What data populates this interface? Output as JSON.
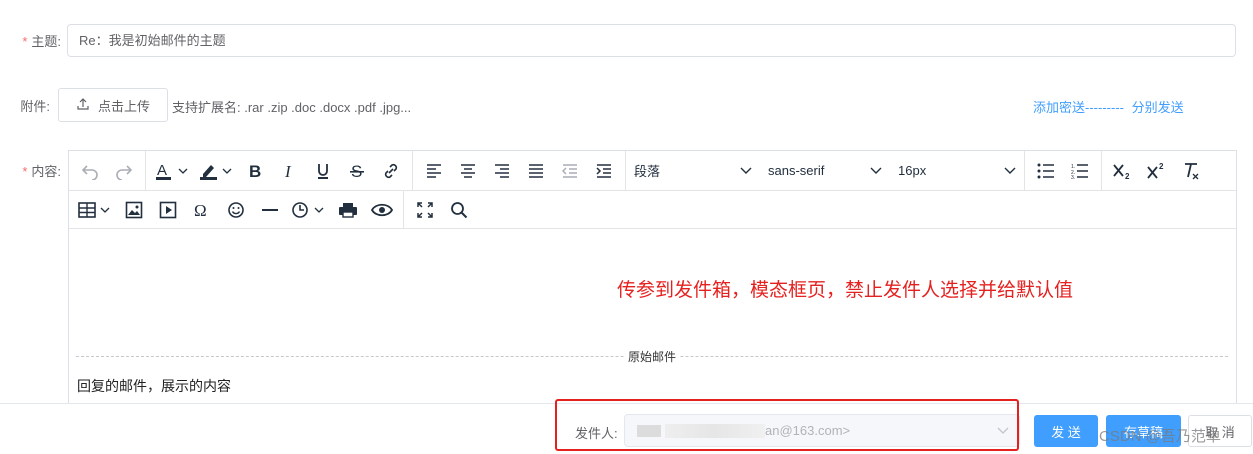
{
  "form": {
    "subject": {
      "label": "主题:",
      "required": true,
      "value": "Re：我是初始邮件的主题"
    },
    "attachment": {
      "label": "附件:",
      "upload_button": "点击上传",
      "hint": "支持扩展名: .rar .zip .doc .docx .pdf .jpg...",
      "add_cc_link": "添加密送---------",
      "separate_send_link": "分别发送"
    },
    "content": {
      "label": "内容:",
      "required": true
    }
  },
  "editor": {
    "toolbar": {
      "block_format": "段落",
      "font_family": "sans-serif",
      "font_size": "16px",
      "icons": [
        "undo-icon",
        "redo-icon",
        "text-color-icon",
        "highlight-icon",
        "bold-icon",
        "italic-icon",
        "underline-icon",
        "strikethrough-icon",
        "link-icon",
        "align-left-icon",
        "align-center-icon",
        "align-right-icon",
        "align-justify-icon",
        "outdent-icon",
        "indent-icon",
        "bullet-list-icon",
        "numbered-list-icon",
        "subscript-icon",
        "superscript-icon",
        "clear-format-icon",
        "table-icon",
        "image-icon",
        "media-icon",
        "special-char-icon",
        "emoticon-icon",
        "horizontal-rule-icon",
        "datetime-icon",
        "print-icon",
        "preview-icon",
        "fullscreen-icon",
        "search-icon"
      ]
    },
    "annotation": "传参到发件箱，模态框页，禁止发件人选择并给默认值",
    "divider_label": "原始邮件",
    "reply_content": "回复的邮件，展示的内容"
  },
  "footer": {
    "sender_label": "发件人:",
    "sender_value_suffix": "an@163.com>",
    "send_button": "发 送",
    "draft_button": "存草稿",
    "cancel_button": "取 消"
  },
  "watermark": "CSDN @吾乃范单",
  "colors": {
    "primary": "#409eff",
    "annotation_red": "#e5211f",
    "required": "#f56c6c"
  }
}
